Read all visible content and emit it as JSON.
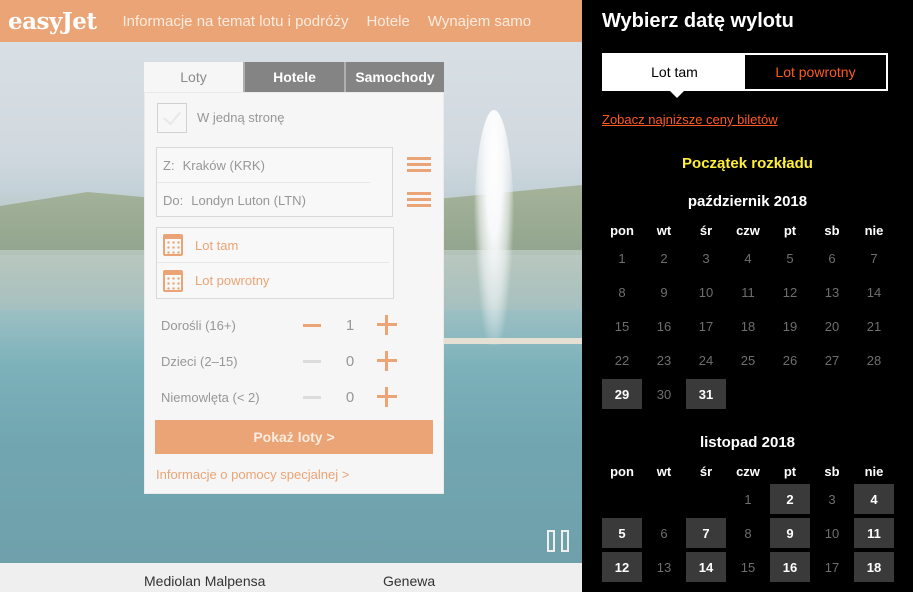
{
  "header": {
    "logo": "easyJet",
    "nav": [
      "Informacje na temat lotu i podróży",
      "Hotele",
      "Wynajem samo"
    ]
  },
  "booking": {
    "tabs": [
      "Loty",
      "Hotele",
      "Samochody"
    ],
    "one_way_label": "W jedną stronę",
    "from_prefix": "Z:",
    "from_value": "Kraków (KRK)",
    "to_prefix": "Do:",
    "to_value": "Londyn Luton (LTN)",
    "outbound_label": "Lot tam",
    "return_label": "Lot powrotny",
    "adults_label": "Dorośli (16+)",
    "adults_value": "1",
    "children_label": "Dzieci (2–15)",
    "children_value": "0",
    "infants_label": "Niemowlęta (< 2)",
    "infants_value": "0",
    "show_flights": "Pokaż loty >",
    "special_help": "Informacje o pomocy specjalnej >"
  },
  "bottom_bar": [
    "Mediolan Malpensa",
    "Genewa"
  ],
  "datepicker": {
    "title": "Wybierz datę wylotu",
    "tab_outbound": "Lot tam",
    "tab_return": "Lot powrotny",
    "lowest_prices_link": "Zobacz najniższe ceny biletów",
    "schedule_start": "Początek rozkładu",
    "weekdays": [
      "pon",
      "wt",
      "śr",
      "czw",
      "pt",
      "sb",
      "nie"
    ],
    "months": [
      {
        "title": "październik 2018",
        "first_weekday": 0,
        "days": 31,
        "available": [
          29,
          31
        ]
      },
      {
        "title": "listopad 2018",
        "first_weekday": 3,
        "days": 18,
        "available": [
          2,
          4,
          5,
          7,
          9,
          11,
          12,
          14,
          16,
          18
        ]
      }
    ]
  },
  "colors": {
    "brand_orange": "#e07a36",
    "accent_red": "#ff5a1f",
    "schedule_yellow": "#ffef36"
  }
}
